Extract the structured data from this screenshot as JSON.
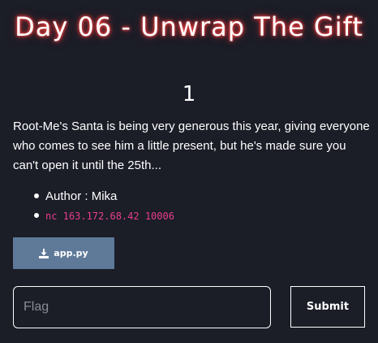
{
  "challenge": {
    "title": "Day 06 - Unwrap The Gift",
    "points": "1",
    "description": "Root-Me's Santa is being very generous this year, giving everyone who comes to see him a little present, but he's made sure you can't open it until the 25th...",
    "author": "Author : Mika",
    "connection": "nc 163.172.68.42 10006"
  },
  "download": {
    "label": "app.py",
    "icon": "download-icon"
  },
  "flag_form": {
    "placeholder": "Flag",
    "value": "",
    "submit_label": "Submit"
  },
  "colors": {
    "background": "#1b1d27",
    "title_glow": "#ff3b3b",
    "code_text": "#e83e8c",
    "download_button": "#5f7a99"
  }
}
